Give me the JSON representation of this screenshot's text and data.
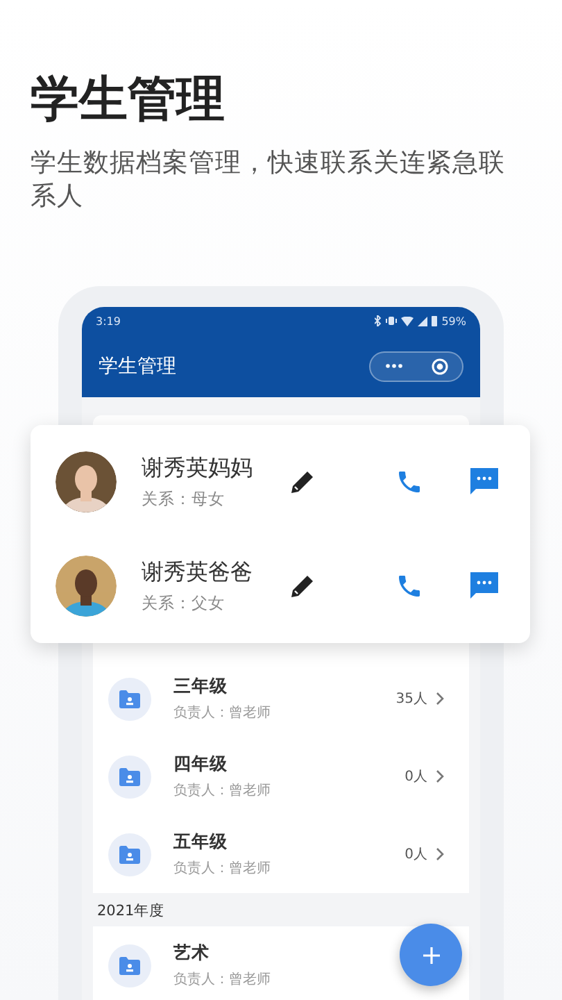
{
  "header": {
    "title": "学生管理",
    "subtitle": "学生数据档案管理，快速联系关连紧急联系人"
  },
  "phone": {
    "status_bar": {
      "time": "3:19",
      "battery": "59%"
    },
    "app_bar": {
      "title": "学生管理"
    },
    "classes": [
      {
        "name": "三年级",
        "manager": "负责人：曾老师",
        "count": "35人"
      },
      {
        "name": "四年级",
        "manager": "负责人：曾老师",
        "count": "0人"
      },
      {
        "name": "五年级",
        "manager": "负责人：曾老师",
        "count": "0人"
      }
    ],
    "sections": [
      {
        "heading": "2021年度",
        "classes": [
          {
            "name": "艺术",
            "manager": "负责人：曾老师"
          }
        ]
      }
    ]
  },
  "contacts": [
    {
      "name": "谢秀英妈妈",
      "relation": "关系：母女"
    },
    {
      "name": "谢秀英爸爸",
      "relation": "关系：父女"
    }
  ]
}
